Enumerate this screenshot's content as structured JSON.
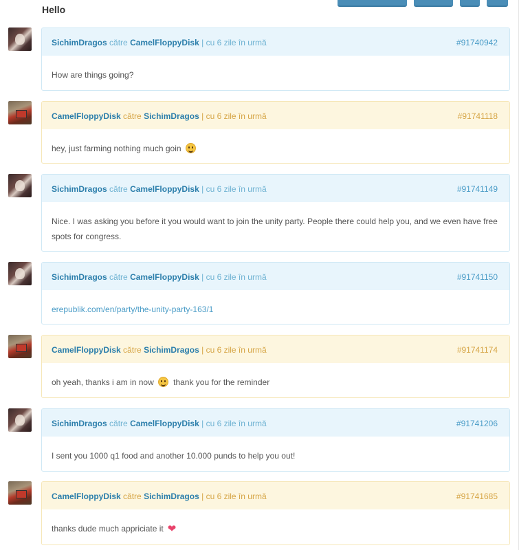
{
  "conversation": {
    "title": "Hello"
  },
  "messages": [
    {
      "from": "SichimDragos",
      "connector": "către",
      "to": "CamelFloppyDisk",
      "time": "| cu 6 zile în urmă",
      "id": "#91740942",
      "text": "How are things going?",
      "style": "blue",
      "avatar": "sichim"
    },
    {
      "from": "CamelFloppyDisk",
      "connector": "către",
      "to": "SichimDragos",
      "time": "| cu 6 zile în urmă",
      "id": "#91741118",
      "text": "hey, just farming nothing much goin",
      "emoji": "smile",
      "style": "yellow",
      "avatar": "camel"
    },
    {
      "from": "SichimDragos",
      "connector": "către",
      "to": "CamelFloppyDisk",
      "time": "| cu 6 zile în urmă",
      "id": "#91741149",
      "text": "Nice. I was asking you before it you would want to join the unity party. People there could help you, and we even have free spots for congress.",
      "style": "blue",
      "avatar": "sichim"
    },
    {
      "from": "SichimDragos",
      "connector": "către",
      "to": "CamelFloppyDisk",
      "time": "| cu 6 zile în urmă",
      "id": "#91741150",
      "text": "erepublik.com/en/party/the-unity-party-163/1",
      "isLink": true,
      "style": "blue",
      "avatar": "sichim"
    },
    {
      "from": "CamelFloppyDisk",
      "connector": "către",
      "to": "SichimDragos",
      "time": "| cu 6 zile în urmă",
      "id": "#91741174",
      "text": "oh yeah, thanks i am in now",
      "emoji": "smile",
      "text_after": "thank you for the reminder",
      "style": "yellow",
      "avatar": "camel"
    },
    {
      "from": "SichimDragos",
      "connector": "către",
      "to": "CamelFloppyDisk",
      "time": "| cu 6 zile în urmă",
      "id": "#91741206",
      "text": "I sent you 1000 q1 food and another 10.000 punds to help you out!",
      "style": "blue",
      "avatar": "sichim"
    },
    {
      "from": "CamelFloppyDisk",
      "connector": "către",
      "to": "SichimDragos",
      "time": "| cu 6 zile în urmă",
      "id": "#91741685",
      "text": "thanks dude much appriciate it",
      "emoji": "heart",
      "style": "yellow",
      "avatar": "camel"
    }
  ],
  "colors": {
    "blue_header": "#e8f5fc",
    "yellow_header": "#fdf6df",
    "username": "#2b7eab",
    "button": "#4a8db7"
  },
  "icons": {
    "smile": "smiling-face-emoji-icon",
    "heart": "heart-emoji-icon"
  }
}
